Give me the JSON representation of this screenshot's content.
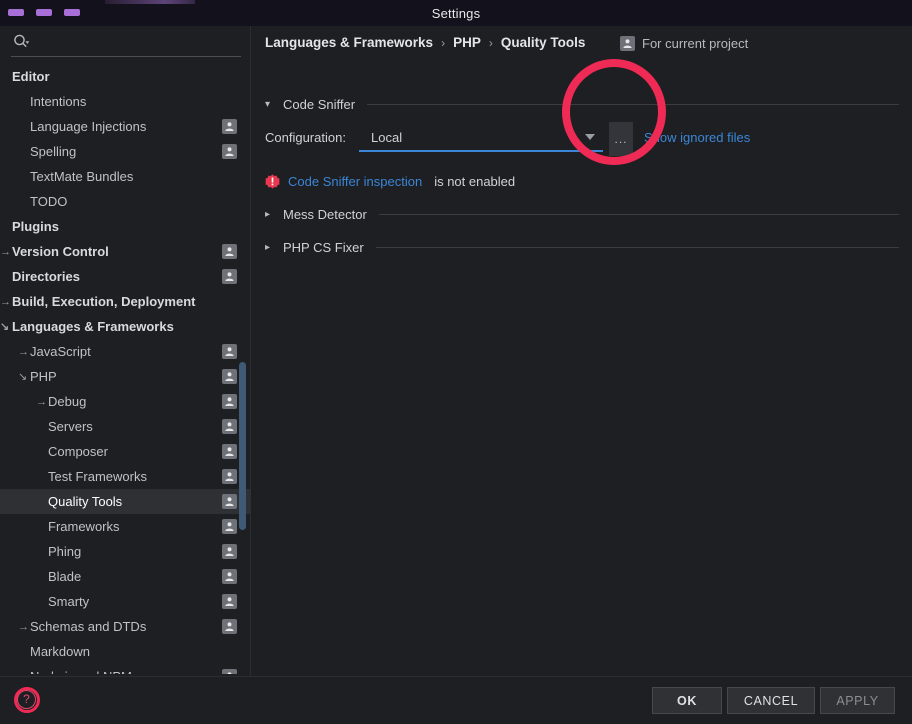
{
  "window": {
    "title": "Settings",
    "controls": [
      "minimize",
      "maximize",
      "close"
    ]
  },
  "sidebar": {
    "search": {
      "value": "",
      "placeholder": ""
    },
    "items": [
      {
        "label": "Editor",
        "depth": 0,
        "bold": true,
        "arrow": "",
        "badge": false,
        "selected": false
      },
      {
        "label": "Intentions",
        "depth": 1,
        "bold": false,
        "arrow": "",
        "badge": false,
        "selected": false
      },
      {
        "label": "Language Injections",
        "depth": 1,
        "bold": false,
        "arrow": "",
        "badge": true,
        "selected": false
      },
      {
        "label": "Spelling",
        "depth": 1,
        "bold": false,
        "arrow": "",
        "badge": true,
        "selected": false
      },
      {
        "label": "TextMate Bundles",
        "depth": 1,
        "bold": false,
        "arrow": "",
        "badge": false,
        "selected": false
      },
      {
        "label": "TODO",
        "depth": 1,
        "bold": false,
        "arrow": "",
        "badge": false,
        "selected": false
      },
      {
        "label": "Plugins",
        "depth": 0,
        "bold": true,
        "arrow": "",
        "badge": false,
        "selected": false
      },
      {
        "label": "Version Control",
        "depth": 0,
        "bold": true,
        "arrow": "collapsed",
        "badge": true,
        "selected": false
      },
      {
        "label": "Directories",
        "depth": 0,
        "bold": true,
        "arrow": "",
        "badge": true,
        "selected": false
      },
      {
        "label": "Build, Execution, Deployment",
        "depth": 0,
        "bold": true,
        "arrow": "collapsed",
        "badge": false,
        "selected": false
      },
      {
        "label": "Languages & Frameworks",
        "depth": 0,
        "bold": true,
        "arrow": "expanded",
        "badge": false,
        "selected": false
      },
      {
        "label": "JavaScript",
        "depth": 1,
        "bold": false,
        "arrow": "collapsed",
        "badge": true,
        "selected": false
      },
      {
        "label": "PHP",
        "depth": 1,
        "bold": false,
        "arrow": "expanded",
        "badge": true,
        "selected": false
      },
      {
        "label": "Debug",
        "depth": 2,
        "bold": false,
        "arrow": "collapsed",
        "badge": true,
        "selected": false
      },
      {
        "label": "Servers",
        "depth": 2,
        "bold": false,
        "arrow": "",
        "badge": true,
        "selected": false
      },
      {
        "label": "Composer",
        "depth": 2,
        "bold": false,
        "arrow": "",
        "badge": true,
        "selected": false
      },
      {
        "label": "Test Frameworks",
        "depth": 2,
        "bold": false,
        "arrow": "",
        "badge": true,
        "selected": false
      },
      {
        "label": "Quality Tools",
        "depth": 2,
        "bold": false,
        "arrow": "",
        "badge": true,
        "selected": true
      },
      {
        "label": "Frameworks",
        "depth": 2,
        "bold": false,
        "arrow": "",
        "badge": true,
        "selected": false
      },
      {
        "label": "Phing",
        "depth": 2,
        "bold": false,
        "arrow": "",
        "badge": true,
        "selected": false
      },
      {
        "label": "Blade",
        "depth": 2,
        "bold": false,
        "arrow": "",
        "badge": true,
        "selected": false
      },
      {
        "label": "Smarty",
        "depth": 2,
        "bold": false,
        "arrow": "",
        "badge": true,
        "selected": false
      },
      {
        "label": "Schemas and DTDs",
        "depth": 1,
        "bold": false,
        "arrow": "collapsed",
        "badge": true,
        "selected": false
      },
      {
        "label": "Markdown",
        "depth": 1,
        "bold": false,
        "arrow": "",
        "badge": false,
        "selected": false
      },
      {
        "label": "Node.js and NPM",
        "depth": 1,
        "bold": false,
        "arrow": "",
        "badge": true,
        "selected": false
      }
    ]
  },
  "main": {
    "breadcrumb": [
      "Languages & Frameworks",
      "PHP",
      "Quality Tools"
    ],
    "breadcrumb_separator": "›",
    "project_scope": "For current project",
    "sections": {
      "code_sniffer": {
        "title": "Code Sniffer",
        "state": "expanded"
      },
      "mess_detector": {
        "title": "Mess Detector",
        "state": "collapsed"
      },
      "php_cs_fixer": {
        "title": "PHP CS Fixer",
        "state": "collapsed"
      }
    },
    "configuration": {
      "label": "Configuration:",
      "value": "Local",
      "options": [
        "Local"
      ],
      "ellipsis_button": "...",
      "ignored_files_link": "Show ignored files"
    },
    "warning": {
      "link_text": "Code Sniffer inspection",
      "rest_text": "is not enabled"
    }
  },
  "footer": {
    "help": "?",
    "ok": "OK",
    "cancel": "CANCEL",
    "apply": "APPLY"
  },
  "annotations": {
    "circles": [
      {
        "name": "configuration-dropdown-highlight",
        "color": "#ef2a55"
      },
      {
        "name": "help-button-highlight",
        "color": "#ef2a55"
      }
    ]
  },
  "colors": {
    "background": "#1e1f22",
    "titlebar": "#13111b",
    "accent_link": "#3b86d6",
    "selection": "#2e3033",
    "annotation": "#ef2a55",
    "help_icon": "#e04a6e",
    "window_control": "#a86fd8"
  }
}
